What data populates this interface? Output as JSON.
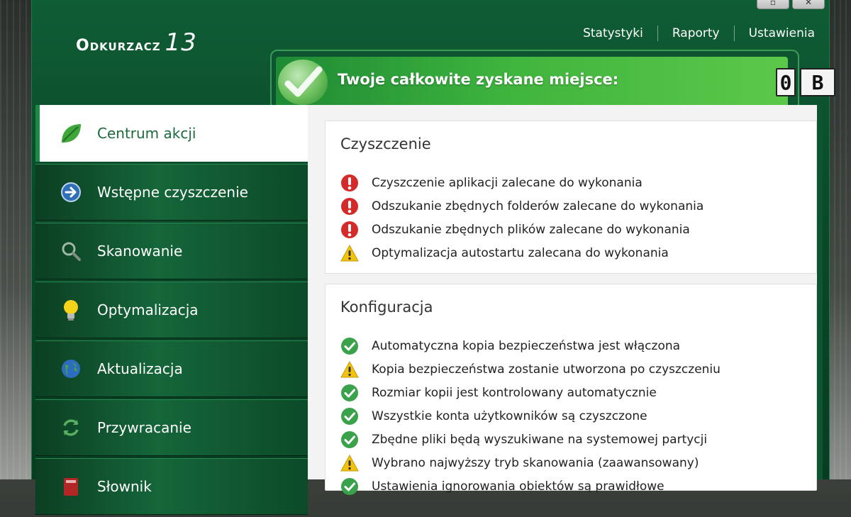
{
  "app": {
    "name": "Odkurzacz",
    "version": "13",
    "window_controls": [
      "▫",
      "✕"
    ]
  },
  "topnav": {
    "items": [
      "Statystyki",
      "Raporty",
      "Ustawienia"
    ]
  },
  "banner": {
    "text": "Twoje całkowite zyskane miejsce:",
    "value": "0",
    "unit": "B"
  },
  "sidebar": {
    "items": [
      {
        "label": "Centrum akcji",
        "icon": "leaf-icon",
        "active": true
      },
      {
        "label": "Wstępne czyszczenie",
        "icon": "arrow-right-icon",
        "active": false
      },
      {
        "label": "Skanowanie",
        "icon": "magnifier-icon",
        "active": false
      },
      {
        "label": "Optymalizacja",
        "icon": "lightbulb-icon",
        "active": false
      },
      {
        "label": "Aktualizacja",
        "icon": "globe-icon",
        "active": false
      },
      {
        "label": "Przywracanie",
        "icon": "restore-arrows-icon",
        "active": false
      },
      {
        "label": "Słownik",
        "icon": "book-icon",
        "active": false
      }
    ]
  },
  "sections": [
    {
      "title": "Czyszczenie",
      "rows": [
        {
          "status": "error",
          "text": "Czyszczenie aplikacji zalecane do wykonania"
        },
        {
          "status": "error",
          "text": "Odszukanie zbędnych folderów zalecane do wykonania"
        },
        {
          "status": "error",
          "text": "Odszukanie zbędnych plików zalecane do wykonania"
        },
        {
          "status": "warning",
          "text": "Optymalizacja autostartu zalecana do wykonania"
        }
      ]
    },
    {
      "title": "Konfiguracja",
      "rows": [
        {
          "status": "ok",
          "text": "Automatyczna kopia bezpieczeństwa jest włączona"
        },
        {
          "status": "warning",
          "text": "Kopia bezpieczeństwa zostanie utworzona po czyszczeniu"
        },
        {
          "status": "ok",
          "text": "Rozmiar kopii jest kontrolowany automatycznie"
        },
        {
          "status": "ok",
          "text": "Wszystkie konta użytkowników są czyszczone"
        },
        {
          "status": "ok",
          "text": "Zbędne pliki będą wyszukiwane na systemowej partycji"
        },
        {
          "status": "warning",
          "text": "Wybrano najwyższy tryb skanowania (zaawansowany)"
        },
        {
          "status": "ok",
          "text": "Ustawienia ignorowania obiektów są prawidłowe"
        }
      ]
    }
  ],
  "colors": {
    "brand_green": "#0f5d35",
    "banner_green": "#3fb43d",
    "error_red": "#d42a2a",
    "warning_yellow": "#f2c20f",
    "ok_green": "#3aa24a"
  }
}
